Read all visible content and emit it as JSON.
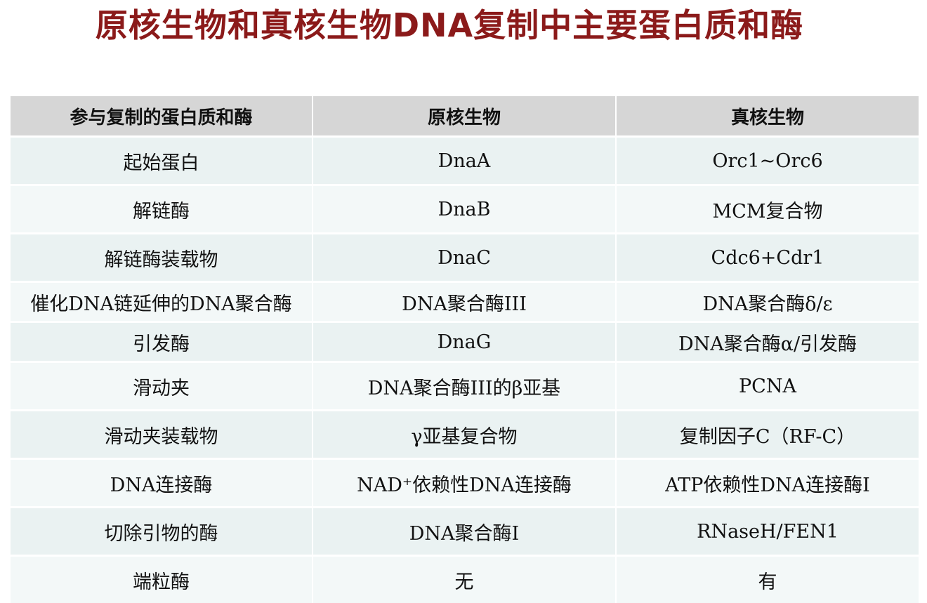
{
  "title": "原核生物和真核生物DNA复制中主要蛋白质和酶",
  "table": {
    "headers": [
      "参与复制的蛋白质和酶",
      "原核生物",
      "真核生物"
    ],
    "rows": [
      [
        "起始蛋白",
        "DnaA",
        "Orc1~Orc6"
      ],
      [
        "解链酶",
        "DnaB",
        "MCM复合物"
      ],
      [
        "解链酶装载物",
        "DnaC",
        "Cdc6+Cdr1"
      ],
      [
        "催化DNA链延伸的DNA聚合酶",
        "DNA聚合酶III",
        "DNA聚合酶δ/ε"
      ],
      [
        "引发酶",
        "DnaG",
        "DNA聚合酶α/引发酶"
      ],
      [
        "滑动夹",
        "DNA聚合酶III的β亚基",
        "PCNA"
      ],
      [
        "滑动夹装载物",
        "γ亚基复合物",
        "复制因子C（RF-C）"
      ],
      [
        "DNA连接酶",
        "NAD⁺依赖性DNA连接酶",
        "ATP依赖性DNA连接酶I"
      ],
      [
        "切除引物的酶",
        "DNA聚合酶I",
        "RNaseH/FEN1"
      ],
      [
        "端粒酶",
        "无",
        "有"
      ]
    ]
  },
  "colors": {
    "title": "#8b1a1a",
    "header_bg": "#d6d6d6",
    "row_bg": "#eaf2f2",
    "row_bg_alt": "#f3f8f8"
  }
}
